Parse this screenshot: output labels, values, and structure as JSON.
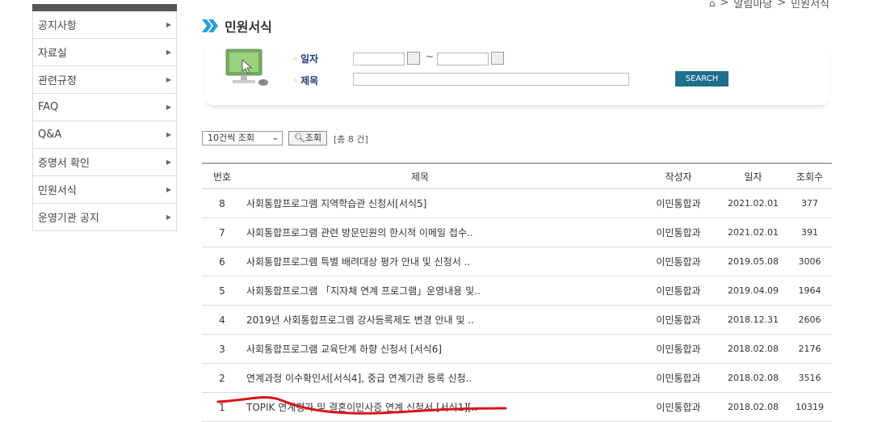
{
  "breadcrumb": {
    "home_icon": "home-icon",
    "items": [
      "알림마당",
      "민원서식"
    ]
  },
  "page_title": "민원서식",
  "sidebar": {
    "items": [
      {
        "label": "공지사항"
      },
      {
        "label": "자료실"
      },
      {
        "label": "관련규정"
      },
      {
        "label": "FAQ"
      },
      {
        "label": "Q&A"
      },
      {
        "label": "증명서 확인"
      },
      {
        "label": "민원서식"
      },
      {
        "label": "운영기관 공지"
      }
    ]
  },
  "search": {
    "date_label": "일자",
    "title_label": "제목",
    "tilde": "~",
    "search_button": "SEARCH"
  },
  "controls": {
    "page_size": "10건씩 조회",
    "query_button": "조회",
    "total": "[총 8 건]"
  },
  "table": {
    "headers": {
      "no": "번호",
      "title": "제목",
      "author": "작성자",
      "date": "일자",
      "views": "조회수"
    },
    "rows": [
      {
        "no": "8",
        "title": "사회통합프로그램 지역학습관 신청서[서식5]",
        "author": "이민통합과",
        "date": "2021.02.01",
        "views": "377"
      },
      {
        "no": "7",
        "title": "사회통합프로그램 관련 방문민원의 한시적 이메일 접수..",
        "author": "이민통합과",
        "date": "2021.02.01",
        "views": "391"
      },
      {
        "no": "6",
        "title": "사회통합프로그램 특별 배려대상 평가 안내 및 신청서 ..",
        "author": "이민통합과",
        "date": "2019.05.08",
        "views": "3006"
      },
      {
        "no": "5",
        "title": "사회통합프로그램 「지자체 연계 프로그램」운영내용 및..",
        "author": "이민통합과",
        "date": "2019.04.09",
        "views": "1964"
      },
      {
        "no": "4",
        "title": "2019년 사회통합프로그램 강사등록제도 변경 안내 및 ..",
        "author": "이민통합과",
        "date": "2018.12.31",
        "views": "2606"
      },
      {
        "no": "3",
        "title": "사회통합프로그램 교육단계 하향 신청서 [서식6]",
        "author": "이민통합과",
        "date": "2018.02.08",
        "views": "2176"
      },
      {
        "no": "2",
        "title": "연계과정 이수확인서[서식4], 중급 연계기관 등록 신청..",
        "author": "이민통합과",
        "date": "2018.02.08",
        "views": "3516"
      },
      {
        "no": "1",
        "title": "TOPIK 연계평가 및 결혼이민사증 연계 신청서 [서식1][..",
        "author": "이민통합과",
        "date": "2018.02.08",
        "views": "10319"
      }
    ]
  },
  "colors": {
    "accent": "#1f6f8f",
    "chevron": "#2aa0d8",
    "annotation": "#d9141b"
  }
}
